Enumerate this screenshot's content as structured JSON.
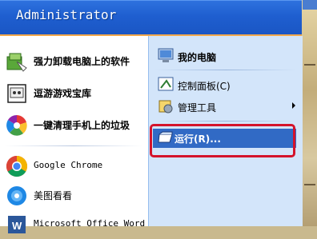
{
  "start_menu": {
    "user_name": "Administrator",
    "pinned_items": [
      {
        "label": "强力卸载电脑上的软件",
        "icon": "software-uninstall-icon"
      },
      {
        "label": "逗游游戏宝库",
        "icon": "game-library-icon"
      },
      {
        "label": "一键清理手机上的垃圾",
        "icon": "phone-cleaner-icon"
      },
      {
        "label": "Google Chrome",
        "icon": "chrome-icon"
      },
      {
        "label": "美图看看",
        "icon": "photo-viewer-icon"
      },
      {
        "label": "Microsoft Office Word",
        "icon": "word-icon"
      }
    ],
    "places": [
      {
        "label": "我的电脑",
        "icon": "my-computer-icon"
      },
      {
        "label": "控制面板(C)",
        "icon": "control-panel-icon"
      },
      {
        "label": "管理工具",
        "icon": "admin-tools-icon"
      },
      {
        "label": "运行(R)...",
        "icon": "run-icon"
      }
    ]
  },
  "colors": {
    "header": "#1f5fd0",
    "right_pane": "#d3e5fa",
    "selection": "#316ac5",
    "annotation_box": "#d4132b"
  }
}
